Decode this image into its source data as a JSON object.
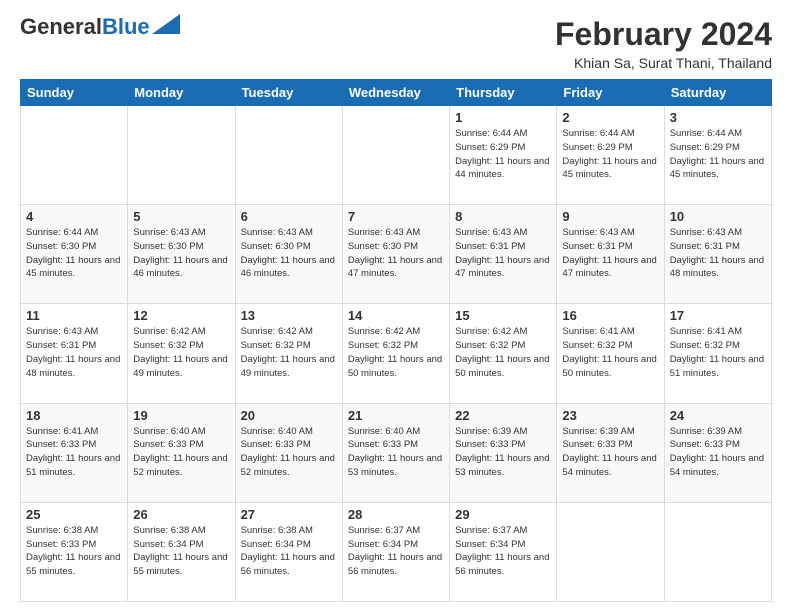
{
  "header": {
    "logo_general": "General",
    "logo_blue": "Blue",
    "month_title": "February 2024",
    "location": "Khian Sa, Surat Thani, Thailand"
  },
  "days_of_week": [
    "Sunday",
    "Monday",
    "Tuesday",
    "Wednesday",
    "Thursday",
    "Friday",
    "Saturday"
  ],
  "weeks": [
    [
      {
        "day": "",
        "info": ""
      },
      {
        "day": "",
        "info": ""
      },
      {
        "day": "",
        "info": ""
      },
      {
        "day": "",
        "info": ""
      },
      {
        "day": "1",
        "info": "Sunrise: 6:44 AM\nSunset: 6:29 PM\nDaylight: 11 hours\nand 44 minutes."
      },
      {
        "day": "2",
        "info": "Sunrise: 6:44 AM\nSunset: 6:29 PM\nDaylight: 11 hours\nand 45 minutes."
      },
      {
        "day": "3",
        "info": "Sunrise: 6:44 AM\nSunset: 6:29 PM\nDaylight: 11 hours\nand 45 minutes."
      }
    ],
    [
      {
        "day": "4",
        "info": "Sunrise: 6:44 AM\nSunset: 6:30 PM\nDaylight: 11 hours\nand 45 minutes."
      },
      {
        "day": "5",
        "info": "Sunrise: 6:43 AM\nSunset: 6:30 PM\nDaylight: 11 hours\nand 46 minutes."
      },
      {
        "day": "6",
        "info": "Sunrise: 6:43 AM\nSunset: 6:30 PM\nDaylight: 11 hours\nand 46 minutes."
      },
      {
        "day": "7",
        "info": "Sunrise: 6:43 AM\nSunset: 6:30 PM\nDaylight: 11 hours\nand 47 minutes."
      },
      {
        "day": "8",
        "info": "Sunrise: 6:43 AM\nSunset: 6:31 PM\nDaylight: 11 hours\nand 47 minutes."
      },
      {
        "day": "9",
        "info": "Sunrise: 6:43 AM\nSunset: 6:31 PM\nDaylight: 11 hours\nand 47 minutes."
      },
      {
        "day": "10",
        "info": "Sunrise: 6:43 AM\nSunset: 6:31 PM\nDaylight: 11 hours\nand 48 minutes."
      }
    ],
    [
      {
        "day": "11",
        "info": "Sunrise: 6:43 AM\nSunset: 6:31 PM\nDaylight: 11 hours\nand 48 minutes."
      },
      {
        "day": "12",
        "info": "Sunrise: 6:42 AM\nSunset: 6:32 PM\nDaylight: 11 hours\nand 49 minutes."
      },
      {
        "day": "13",
        "info": "Sunrise: 6:42 AM\nSunset: 6:32 PM\nDaylight: 11 hours\nand 49 minutes."
      },
      {
        "day": "14",
        "info": "Sunrise: 6:42 AM\nSunset: 6:32 PM\nDaylight: 11 hours\nand 50 minutes."
      },
      {
        "day": "15",
        "info": "Sunrise: 6:42 AM\nSunset: 6:32 PM\nDaylight: 11 hours\nand 50 minutes."
      },
      {
        "day": "16",
        "info": "Sunrise: 6:41 AM\nSunset: 6:32 PM\nDaylight: 11 hours\nand 50 minutes."
      },
      {
        "day": "17",
        "info": "Sunrise: 6:41 AM\nSunset: 6:32 PM\nDaylight: 11 hours\nand 51 minutes."
      }
    ],
    [
      {
        "day": "18",
        "info": "Sunrise: 6:41 AM\nSunset: 6:33 PM\nDaylight: 11 hours\nand 51 minutes."
      },
      {
        "day": "19",
        "info": "Sunrise: 6:40 AM\nSunset: 6:33 PM\nDaylight: 11 hours\nand 52 minutes."
      },
      {
        "day": "20",
        "info": "Sunrise: 6:40 AM\nSunset: 6:33 PM\nDaylight: 11 hours\nand 52 minutes."
      },
      {
        "day": "21",
        "info": "Sunrise: 6:40 AM\nSunset: 6:33 PM\nDaylight: 11 hours\nand 53 minutes."
      },
      {
        "day": "22",
        "info": "Sunrise: 6:39 AM\nSunset: 6:33 PM\nDaylight: 11 hours\nand 53 minutes."
      },
      {
        "day": "23",
        "info": "Sunrise: 6:39 AM\nSunset: 6:33 PM\nDaylight: 11 hours\nand 54 minutes."
      },
      {
        "day": "24",
        "info": "Sunrise: 6:39 AM\nSunset: 6:33 PM\nDaylight: 11 hours\nand 54 minutes."
      }
    ],
    [
      {
        "day": "25",
        "info": "Sunrise: 6:38 AM\nSunset: 6:33 PM\nDaylight: 11 hours\nand 55 minutes."
      },
      {
        "day": "26",
        "info": "Sunrise: 6:38 AM\nSunset: 6:34 PM\nDaylight: 11 hours\nand 55 minutes."
      },
      {
        "day": "27",
        "info": "Sunrise: 6:38 AM\nSunset: 6:34 PM\nDaylight: 11 hours\nand 56 minutes."
      },
      {
        "day": "28",
        "info": "Sunrise: 6:37 AM\nSunset: 6:34 PM\nDaylight: 11 hours\nand 56 minutes."
      },
      {
        "day": "29",
        "info": "Sunrise: 6:37 AM\nSunset: 6:34 PM\nDaylight: 11 hours\nand 56 minutes."
      },
      {
        "day": "",
        "info": ""
      },
      {
        "day": "",
        "info": ""
      }
    ]
  ]
}
